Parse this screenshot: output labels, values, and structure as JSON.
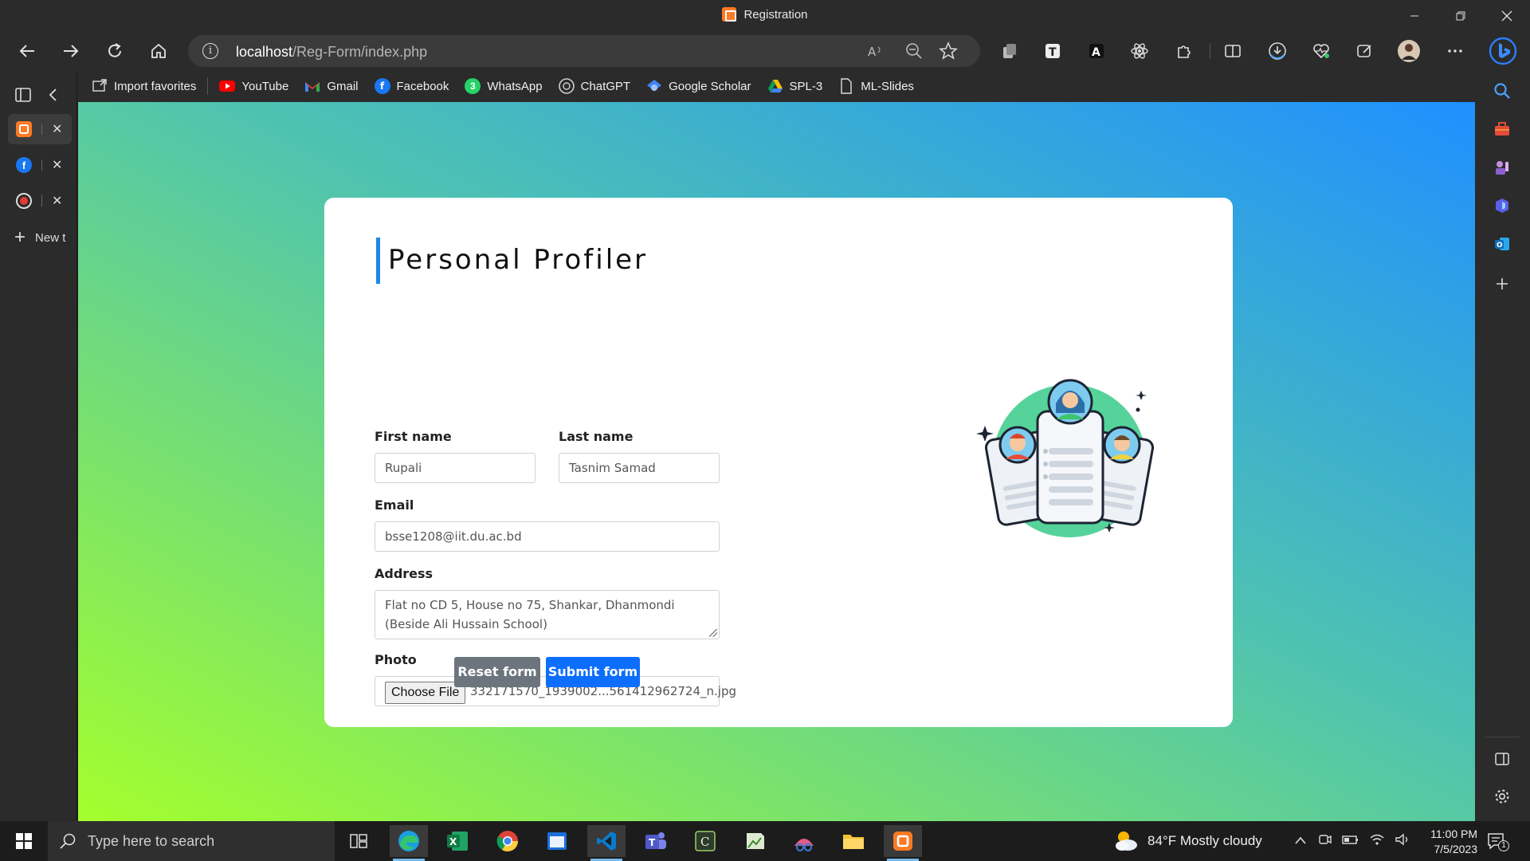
{
  "window": {
    "title": "Registration"
  },
  "toolbar": {
    "address_host": "localhost",
    "address_path": "/Reg-Form/index.php"
  },
  "favorites": [
    {
      "label": "Import favorites",
      "icon": "import-icon"
    },
    {
      "label": "YouTube",
      "icon": "youtube-icon",
      "color": "#ff0000"
    },
    {
      "label": "Gmail",
      "icon": "gmail-icon",
      "color": "#ea4335"
    },
    {
      "label": "Facebook",
      "icon": "facebook-icon",
      "color": "#1877f2"
    },
    {
      "label": "WhatsApp",
      "icon": "whatsapp-icon",
      "color": "#25d366"
    },
    {
      "label": "ChatGPT",
      "icon": "chatgpt-icon",
      "color": "#74aa9c"
    },
    {
      "label": "Google Scholar",
      "icon": "google-scholar-icon",
      "color": "#4285f4"
    },
    {
      "label": "SPL-3",
      "icon": "google-drive-icon"
    },
    {
      "label": "ML-Slides",
      "icon": "page-icon"
    }
  ],
  "tabs": {
    "new_tab_label": "New t"
  },
  "form": {
    "title": "Personal Profiler",
    "first_name_label": "First name",
    "first_name_value": "Rupali",
    "last_name_label": "Last name",
    "last_name_value": "Tasnim Samad",
    "email_label": "Email",
    "email_value": "bsse1208@iit.du.ac.bd",
    "address_label": "Address",
    "address_line1": "Flat no CD 5, House no 75, Shankar, Dhanmondi",
    "address_line2": "(Beside Ali Hussain School)",
    "photo_label": "Photo",
    "choose_file_label": "Choose File",
    "file_name": "332171570_1939002...561412962724_n.jpg",
    "reset_label": "Reset form",
    "submit_label": "Submit form",
    "accent_color": "#1e88e5",
    "submit_color": "#0d6efd",
    "reset_color": "#6c757d"
  },
  "taskbar": {
    "search_placeholder": "Type here to search",
    "weather": "84°F  Mostly cloudy",
    "time": "11:00 PM",
    "date": "7/5/2023",
    "notification_count": "1"
  }
}
